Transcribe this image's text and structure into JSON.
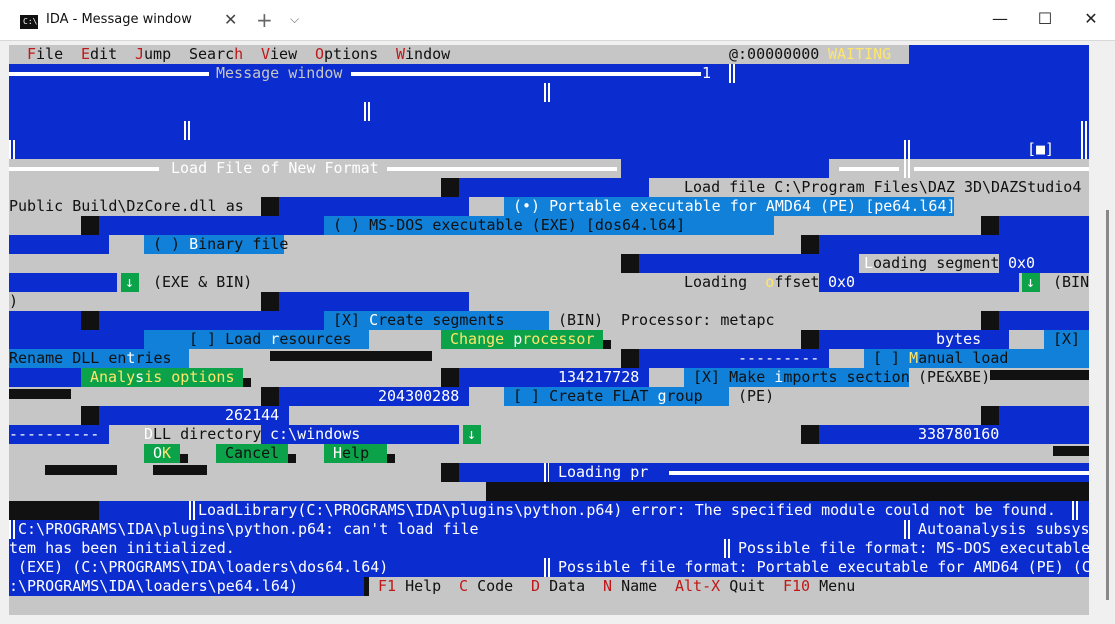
{
  "window": {
    "tab_icon": "C:\\",
    "tab_title": "IDA - Message window",
    "tab_close": "✕",
    "new_tab": "+",
    "tab_dropdown": "⌵",
    "minimize": "—",
    "maximize": "☐",
    "close": "✕"
  },
  "menubar": {
    "items": [
      {
        "hot": "F",
        "rest": "ile"
      },
      {
        "hot": "E",
        "rest": "dit"
      },
      {
        "hot": "J",
        "rest": "ump"
      },
      {
        "pre": "Searc",
        "hot": "h",
        "rest": ""
      },
      {
        "hot": "V",
        "rest": "iew"
      },
      {
        "hot": "O",
        "rest": "ptions"
      },
      {
        "hot": "W",
        "rest": "indow"
      }
    ],
    "address": "@:00000000",
    "status": "WAITING"
  },
  "message_window": {
    "title": "Message window",
    "number": "1"
  },
  "dialog": {
    "title": "Load File of New Format",
    "load_file_label": "Load file C:\\Program Files\\DAZ 3D\\DAZStudio4",
    "load_file_path_tail": "Public Build\\DzCore.dll as",
    "opt_pe": "(•) Portable executable for AMD64 (PE) [pe64.l64]",
    "opt_msdos": "( ) MS-DOS executable (EXE) [dos64.l64]",
    "opt_binary_pre": "( ) ",
    "opt_binary_hot": "B",
    "opt_binary_rest": "inary file",
    "loading_segment_hot": "L",
    "loading_segment_rest": "oading segment",
    "loading_segment_value": "0x0",
    "exe_bin": "(EXE & BIN)",
    "loading_offset_pre": "Loading  ",
    "loading_offset_hot": "o",
    "loading_offset_rest": "ffset",
    "loading_offset_value": "0x0",
    "bin_suffix": "(BIN",
    "paren_close": ")",
    "create_segments_pre": "[X] ",
    "create_segments_hot": "C",
    "create_segments_rest": "reate segments",
    "create_segments_suffix": "(BIN)",
    "processor": "Processor: metapc",
    "load_resources_pre": "[ ] Load ",
    "load_resources_hot": "r",
    "load_resources_rest": "esources",
    "change_processor_pre": "Change ",
    "change_processor_hot": "p",
    "change_processor_rest": "rocessor",
    "bytes": "bytes",
    "x_mark": "[X]",
    "rename_dll_pre": "Rename DLL en",
    "rename_dll_hot": "t",
    "rename_dll_rest": "ries",
    "dashes": "---------",
    "manual_load_pre": "[ ] ",
    "manual_load_hot": "M",
    "manual_load_rest": "anual load",
    "analysis_pre": "Analy",
    "analysis_hot": "s",
    "analysis_rest": "is options",
    "value_a": "134217728",
    "make_imports_pre": "[X] Make ",
    "make_imports_hot": "i",
    "make_imports_rest": "mports section",
    "pe_xbe": "(PE&XBE)",
    "value_b": "204300288",
    "flat_group_pre": "[ ] Create FLAT ",
    "flat_group_hot": "g",
    "flat_group_rest": "roup",
    "pe": "(PE)",
    "value_c": "262144",
    "dashes_long": "----------",
    "dll_dir_hot": "D",
    "dll_dir_rest": "LL directory",
    "dll_dir_value": "c:\\windows",
    "value_d": "338780160",
    "ok_hot": "O",
    "ok_rest": "K",
    "cancel": "Cancel",
    "help_hot": "H",
    "help_rest": "elp",
    "loading_pr": "Loading pr"
  },
  "log": [
    "LoadLibrary(C:\\PROGRAMS\\IDA\\plugins\\python.p64) error: The specified module could not be found.",
    "C:\\PROGRAMS\\IDA\\plugins\\python.p64: can't load file",
    "Autoanalysis subsys",
    "tem has been initialized.",
    "Possible file format: MS-DOS executable",
    " (EXE) (C:\\PROGRAMS\\IDA\\loaders\\dos64.l64)",
    "Possible file format: Portable executable for AMD64 (PE) (C",
    ":\\PROGRAMS\\IDA\\loaders\\pe64.l64)"
  ],
  "statusbar": {
    "keys": [
      {
        "key": "F1",
        "label": "Help"
      },
      {
        "key": "C",
        "label": "Code"
      },
      {
        "key": "D",
        "label": "Data"
      },
      {
        "key": "N",
        "label": "Name"
      },
      {
        "key": "Alt-X",
        "label": "Quit"
      },
      {
        "key": "F10",
        "label": "Menu"
      }
    ]
  },
  "glyphs": {
    "down_arrow": "↓",
    "close_box": "[■]",
    "one": "1"
  }
}
